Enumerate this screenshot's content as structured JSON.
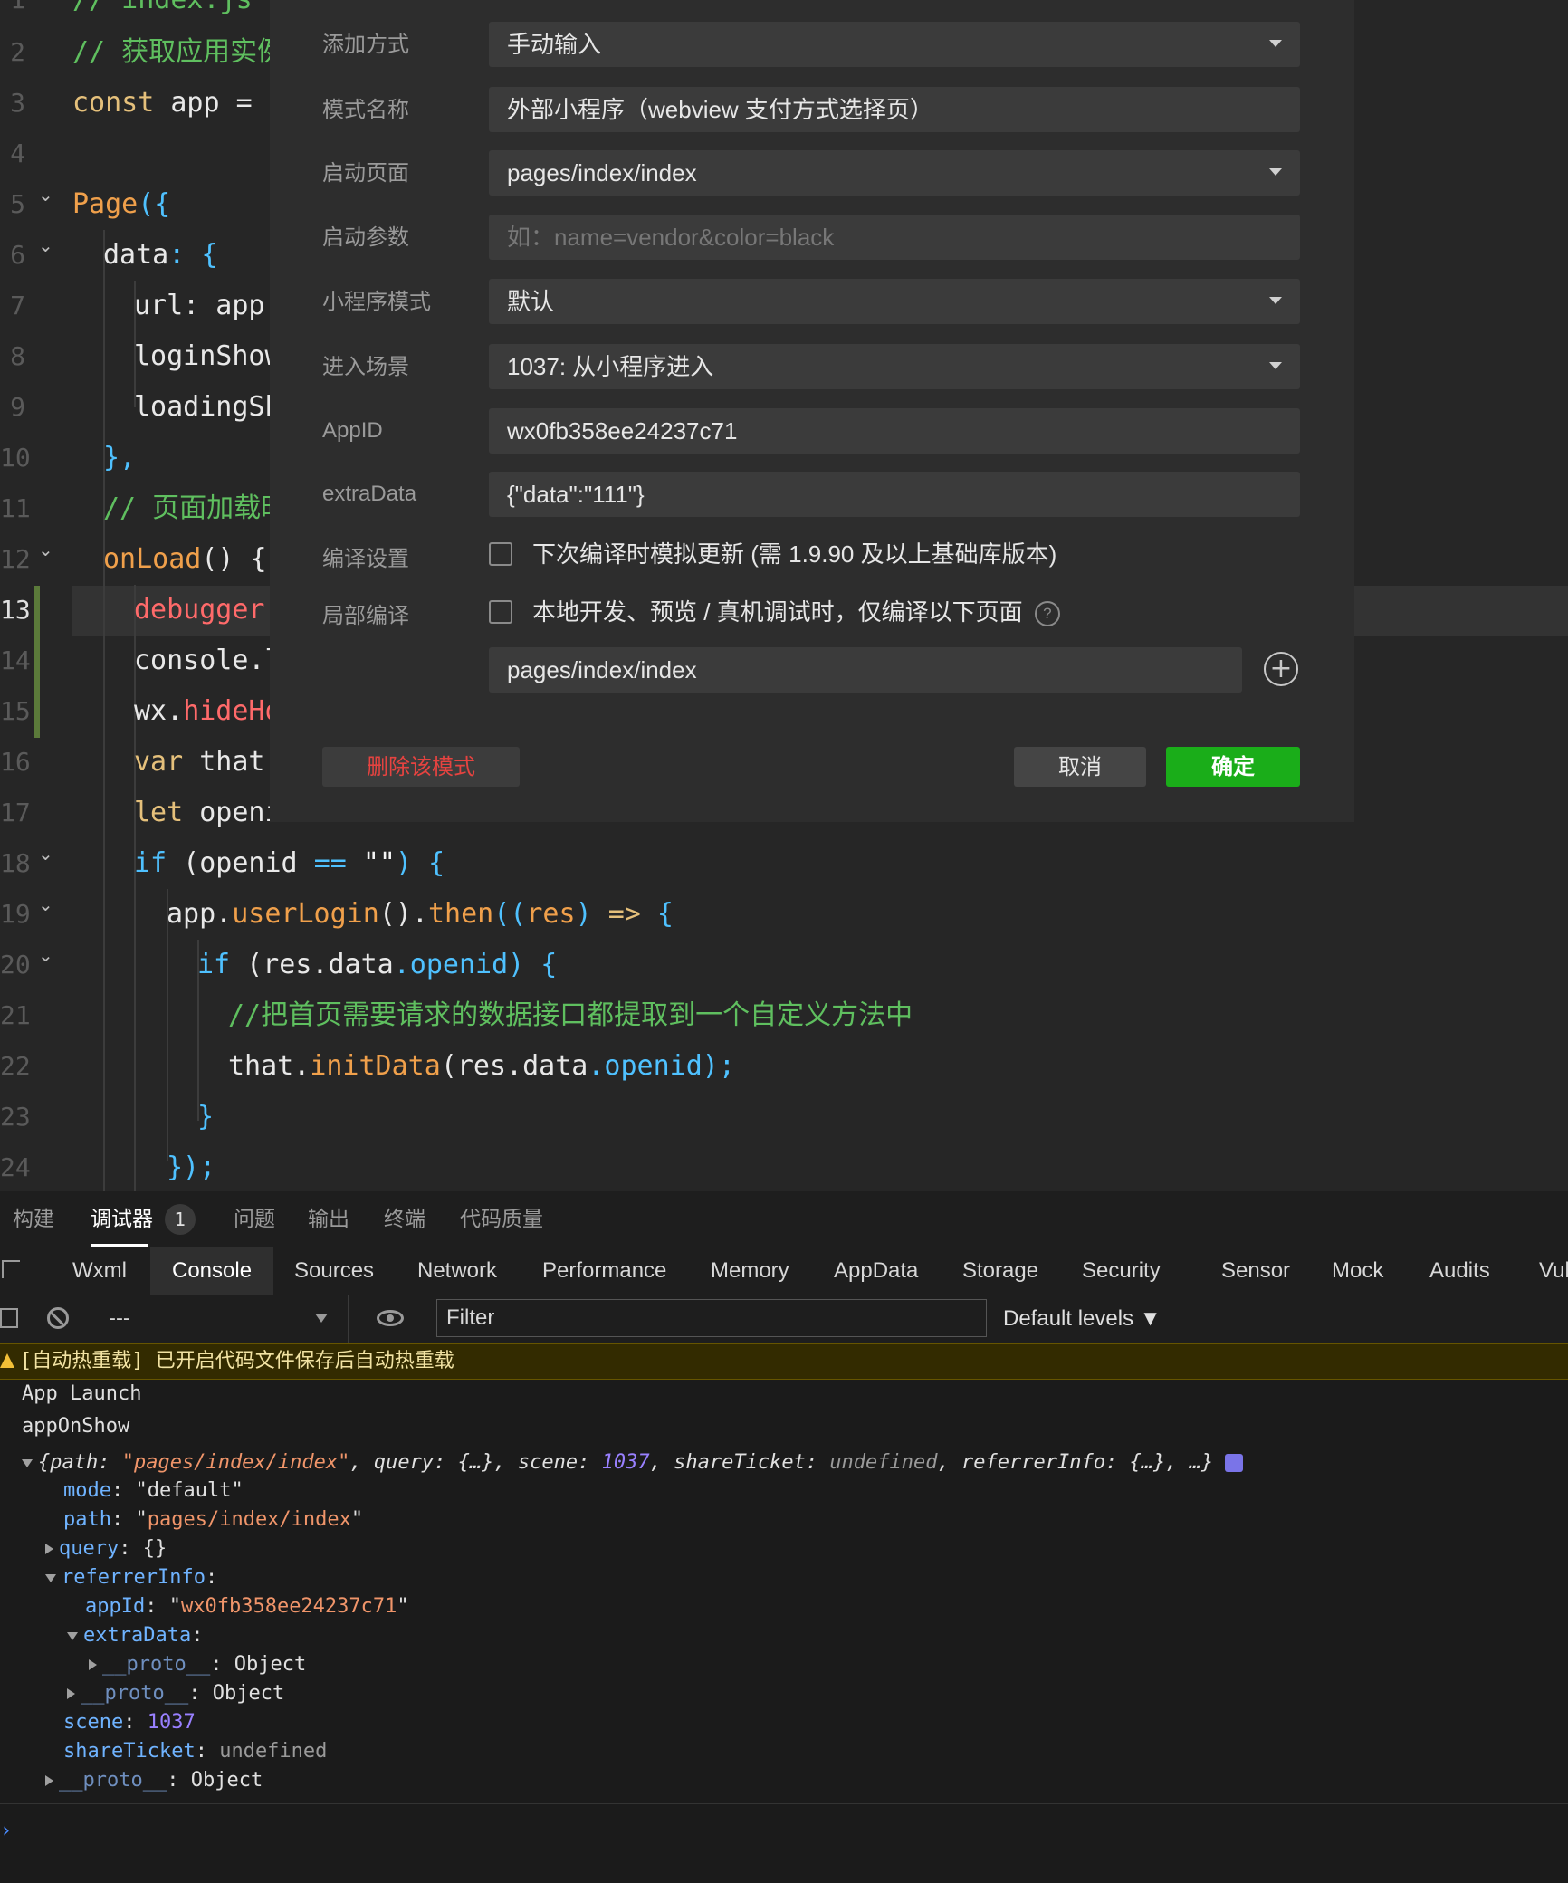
{
  "editor": {
    "line_numbers": [
      "1",
      "2",
      "3",
      "4",
      "5",
      "6",
      "7",
      "8",
      "9",
      "10",
      "11",
      "12",
      "13",
      "14",
      "15",
      "16",
      "17",
      "18",
      "19",
      "20",
      "21",
      "22",
      "23",
      "24"
    ],
    "lines": {
      "l1": "// index.js",
      "l2": "// 获取应用实例",
      "l3a": "const",
      "l3b": " app = ",
      "l5a": "Page",
      "l5b": "({",
      "l6a": "data",
      "l6b": ": {",
      "l7": "url: app.",
      "l8": "loginShow",
      "l9": "loadingSh",
      "l10": "},",
      "l11": "// 页面加载时",
      "l12a": "onLoad",
      "l12b": "() {",
      "l13": "debugger",
      "l14": "console.l",
      "l15a": "wx.",
      "l15b": "hideHo",
      "l16a": "var",
      "l16b": " that",
      "l17a": "let",
      "l17b": " openi",
      "l18a": "if",
      "l18b": " (openid ",
      "l18c": "==",
      "l18d": " \"\"",
      "l18e": ") {",
      "l19a": "app.",
      "l19b": "userLogin",
      "l19c": "().",
      "l19d": "then",
      "l19e": "((",
      "l19f": "res",
      "l19g": ") ",
      "l19h": "=>",
      "l19i": " {",
      "l20a": "if",
      "l20b": " (res.",
      "l20c": "data",
      "l20d": ".openid) {",
      "l21": "//把首页需要请求的数据接口都提取到一个自定义方法中",
      "l22a": "that.",
      "l22b": "initData",
      "l22c": "(res.",
      "l22d": "data",
      "l22e": ".openid);",
      "l23": "}",
      "l24": "});"
    }
  },
  "dialog": {
    "rows": {
      "add_mode": {
        "label": "添加方式",
        "value": "手动输入"
      },
      "mode_name": {
        "label": "模式名称",
        "value": "外部小程序（webview 支付方式选择页）"
      },
      "start_page": {
        "label": "启动页面",
        "value": "pages/index/index"
      },
      "start_params": {
        "label": "启动参数",
        "placeholder": "如：name=vendor&color=black"
      },
      "mp_mode": {
        "label": "小程序模式",
        "value": "默认"
      },
      "scene": {
        "label": "进入场景",
        "value": "1037: 从小程序进入"
      },
      "appid": {
        "label": "AppID",
        "value": "wx0fb358ee24237c71"
      },
      "extra": {
        "label": "extraData",
        "value": "{\"data\":\"111\"}"
      },
      "compile": {
        "label": "编译设置",
        "text": "下次编译时模拟更新 (需 1.9.90 及以上基础库版本)"
      },
      "partial": {
        "label": "局部编译",
        "text": "本地开发、预览 / 真机调试时，仅编译以下页面"
      },
      "partial_page": {
        "value": "pages/index/index"
      }
    },
    "buttons": {
      "delete": "删除该模式",
      "cancel": "取消",
      "ok": "确定"
    }
  },
  "panel_tabs": {
    "build": "构建",
    "debugger": "调试器",
    "badge": "1",
    "issues": "问题",
    "output": "输出",
    "terminal": "终端",
    "quality": "代码质量"
  },
  "devtools_tabs": [
    "Wxml",
    "Console",
    "Sources",
    "Network",
    "Performance",
    "Memory",
    "AppData",
    "Storage",
    "Security",
    "Sensor",
    "Mock",
    "Audits",
    "Vul"
  ],
  "toolbar": {
    "context": "---",
    "filter_placeholder": "Filter",
    "levels": "Default levels ▼"
  },
  "console": {
    "warning": "[自动热重载] 已开启代码文件保存后自动热重载",
    "app_launch": "App Launch",
    "app_onshow": "appOnShow",
    "obj_open": "{",
    "k_path": "path",
    "v_path": "\"pages/index/index\"",
    "k_query": "query",
    "v_query": "{…}",
    "k_scene": "scene",
    "v_scene": "1037",
    "k_share": "shareTicket",
    "v_share": "undefined",
    "k_ref": "referrerInfo",
    "v_ref": "{…}",
    "obj_close": "…}",
    "mode_key": "mode",
    "mode_val": "\"default\"",
    "path_key": "path",
    "path_val": "\"pages/index/index\"",
    "query_key": "query",
    "query_val": "{}",
    "ref_key": "referrerInfo",
    "appid_key": "appId",
    "appid_val": "\"wx0fb358ee24237c71\"",
    "extra_key": "extraData",
    "proto_key": "__proto__",
    "proto_val": "Object",
    "scene_key": "scene",
    "scene_val": "1037",
    "share_key": "shareTicket",
    "share_val": "undefined"
  },
  "colors": {
    "accent_green": "#1aad19",
    "delete_red": "#e64340"
  }
}
